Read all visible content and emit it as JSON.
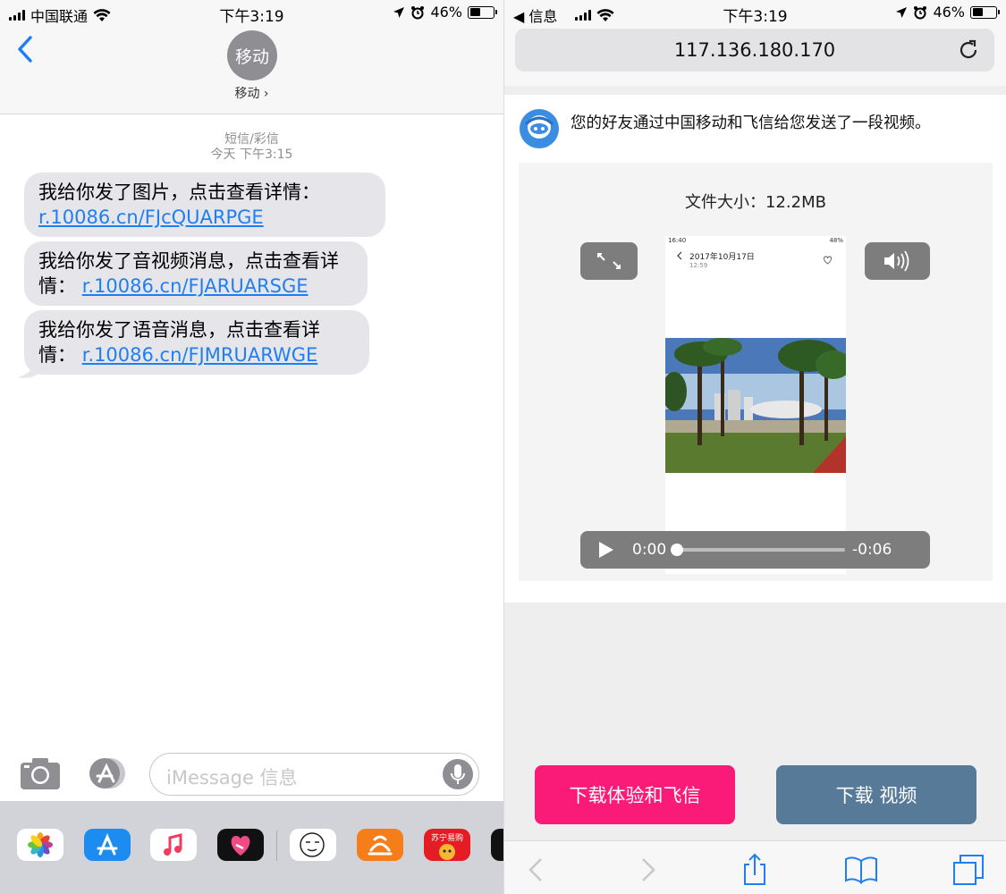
{
  "colors": {
    "ios_blue": "#1f7ff2",
    "bubble_gray": "#e5e5ea",
    "pink": "#fa1a77",
    "slate": "#587a99"
  },
  "left": {
    "status": {
      "carrier": "中国联通",
      "time": "下午3:19",
      "battery": "46%"
    },
    "header": {
      "avatar_text": "移动",
      "contact_name": "移动 ›",
      "back_icon": "chevron-left-icon"
    },
    "thread": {
      "type_label": "短信/彩信",
      "time_label": "今天 下午3:15"
    },
    "messages": [
      {
        "text": "我给你发了图片，点击查看详情：",
        "link": "r.10086.cn/FJcQUARPGE"
      },
      {
        "text": "我给你发了音视频消息，点击查看详情：",
        "link": "r.10086.cn/FJARUARSGE"
      },
      {
        "text": "我给你发了语音消息，点击查看详情：",
        "link": "r.10086.cn/FJMRUARWGE"
      }
    ],
    "input": {
      "placeholder": "iMessage 信息"
    },
    "tray_apps": [
      "photos-icon",
      "app-store-icon",
      "music-icon",
      "heart-app-icon",
      "sticker-face-icon",
      "uc-browser-icon",
      "suning-icon"
    ],
    "tray_suning_label": "苏宁易购"
  },
  "right": {
    "status": {
      "back_app": "◀ 信息",
      "time": "下午3:19",
      "battery": "46%"
    },
    "url": "117.136.180.170",
    "share_text": "您的好友通过中国移动和飞信给您发送了一段视频。",
    "file_size": "文件大小：12.2MB",
    "video": {
      "frame_status_time": "16:40",
      "frame_status_battery": "48%",
      "frame_date": "2017年10月17日",
      "frame_time": "12:59",
      "current_time": "0:00",
      "remaining": "-0:06",
      "progress": 0.0
    },
    "buttons": {
      "download_fetion": "下载体验和飞信",
      "download_video": "下载 视频"
    },
    "toolbar": [
      "back-arrow-icon",
      "forward-arrow-icon",
      "share-icon",
      "bookmarks-icon",
      "tabs-icon"
    ]
  }
}
